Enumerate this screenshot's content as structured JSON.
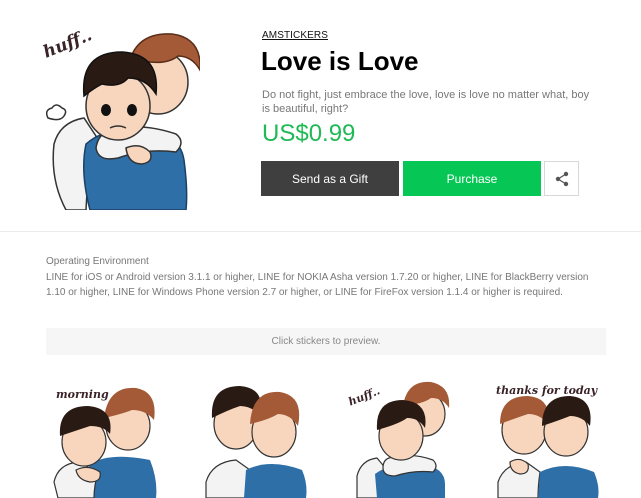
{
  "product": {
    "author": "AMSTICKERS",
    "title": "Love is Love",
    "description": "Do not fight, just embrace the love, love is love no matter what, boy is beautiful, right?",
    "price": "US$0.99",
    "main_sticker_caption": "huff.."
  },
  "actions": {
    "gift_label": "Send as a Gift",
    "purchase_label": "Purchase",
    "share_icon": "share-icon"
  },
  "environment": {
    "heading": "Operating Environment",
    "text": "LINE for iOS or Android version 3.1.1 or higher, LINE for NOKIA Asha version 1.7.20 or higher, LINE for BlackBerry version 1.10 or higher, LINE for Windows Phone version 2.7 or higher, or LINE for FireFox version 1.1.4 or higher is required."
  },
  "preview": {
    "hint": "Click stickers to preview."
  },
  "stickers": [
    {
      "caption": "morning"
    },
    {
      "caption": ""
    },
    {
      "caption": "huff.."
    },
    {
      "caption": "thanks for today"
    }
  ],
  "colors": {
    "price_green": "#1fb955",
    "purchase_green": "#06c755",
    "gift_dark": "#3f3f40",
    "blue_shirt": "#2e6fa8",
    "dark_hair": "#2a1a14",
    "brown_hair": "#a45a36"
  }
}
